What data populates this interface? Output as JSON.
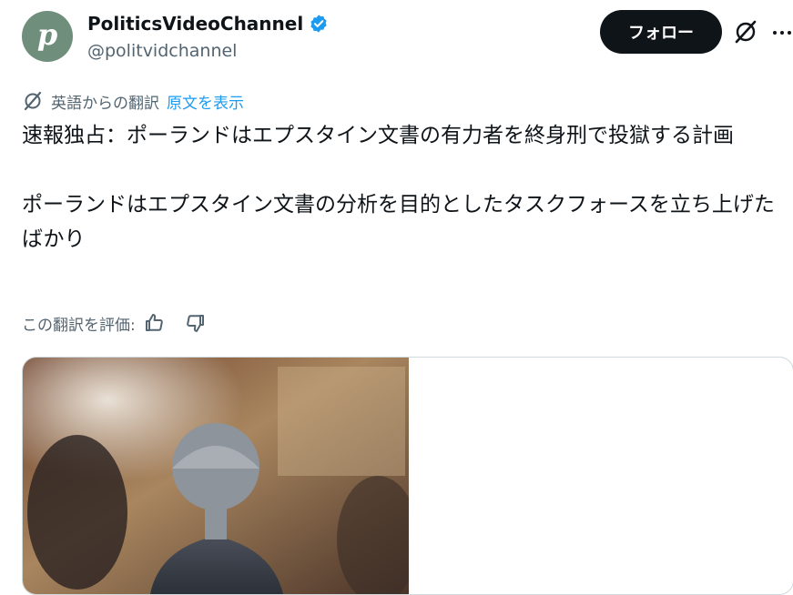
{
  "account": {
    "display_name": "PoliticsVideoChannel",
    "handle": "@politvidchannel",
    "avatar_letter": "p",
    "verified": true
  },
  "actions": {
    "follow_label": "フォロー"
  },
  "translation": {
    "label": "英語からの翻訳",
    "show_original": "原文を表示"
  },
  "tweet": {
    "text": "速報独占：ポーランドはエプスタイン文書の有力者を終身刑で投獄する計画\n\nポーランドはエプスタイン文書の分析を目的としたタスクフォースを立ち上げたばかり"
  },
  "rating": {
    "label": "この翻訳を評価:"
  },
  "colors": {
    "accent": "#1d9bf0",
    "follow_bg": "#0f1419",
    "secondary_text": "#536471",
    "avatar_bg": "#6f8e7c"
  },
  "icons": [
    "verified-badge-icon",
    "grok-icon",
    "more-icon",
    "translate-icon",
    "thumbs-up-icon",
    "thumbs-down-icon"
  ]
}
